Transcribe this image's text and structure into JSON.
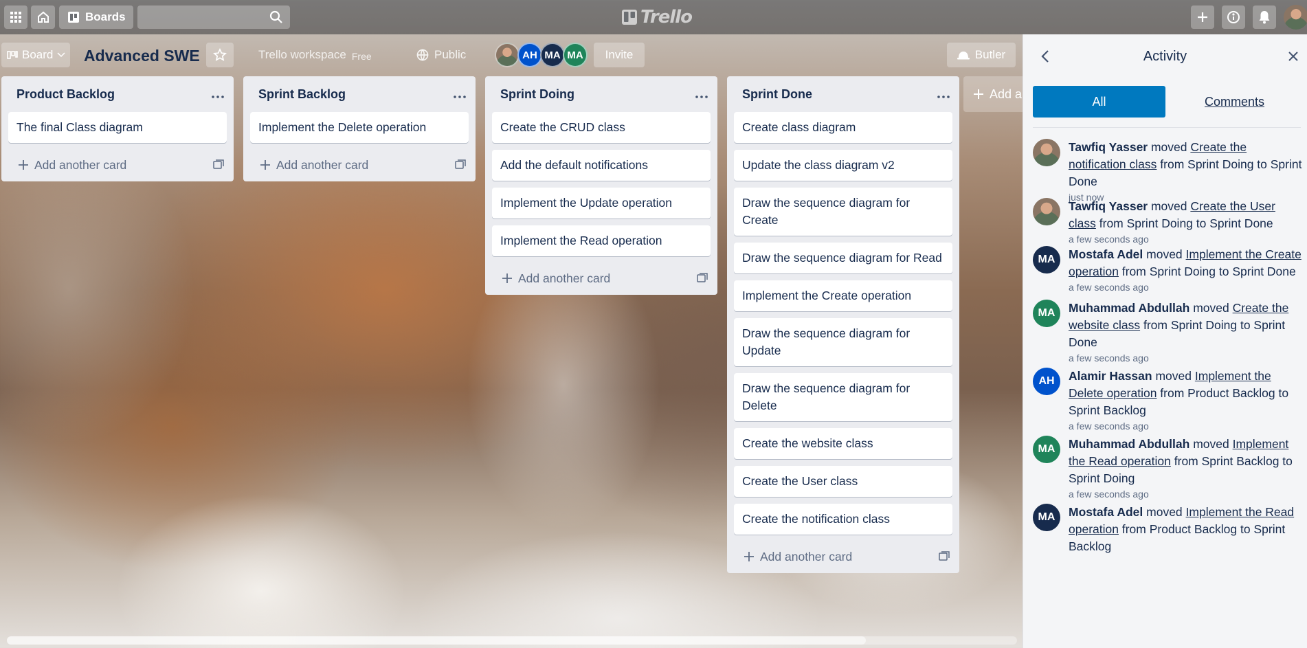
{
  "topbar": {
    "boards_label": "Boards",
    "search_placeholder": "",
    "logo_text": "Trello"
  },
  "board": {
    "view_label": "Board",
    "title": "Advanced SWE",
    "workspace_label": "Trello workspace",
    "workspace_plan": "Free",
    "visibility_label": "Public",
    "members": [
      {
        "initials": "",
        "color": "#8a7564",
        "photo": true
      },
      {
        "initials": "AH",
        "color": "#0052cc"
      },
      {
        "initials": "MA",
        "color": "#172b4d"
      },
      {
        "initials": "MA",
        "color": "#1f845a"
      }
    ],
    "invite_label": "Invite",
    "butler_label": "Butler",
    "add_list_label": "Add a"
  },
  "lists": [
    {
      "title": "Product Backlog",
      "cards": [
        "The final Class diagram"
      ],
      "add_label": "Add another card"
    },
    {
      "title": "Sprint Backlog",
      "cards": [
        "Implement the Delete operation"
      ],
      "add_label": "Add another card"
    },
    {
      "title": "Sprint Doing",
      "cards": [
        "Create the CRUD class",
        "Add the default notifications",
        "Implement the Update operation",
        "Implement the Read operation"
      ],
      "add_label": "Add another card"
    },
    {
      "title": "Sprint Done",
      "cards": [
        "Create class diagram",
        "Update the class diagram v2",
        "Draw the sequence diagram for Create",
        "Draw the sequence diagram for Read",
        "Implement the Create operation",
        "Draw the sequence diagram for Update",
        "Draw the sequence diagram for Delete",
        "Create the website class",
        "Create the User class",
        "Create the notification class"
      ],
      "add_label": "Add another card"
    }
  ],
  "activity": {
    "title": "Activity",
    "tabs": {
      "all": "All",
      "comments": "Comments"
    },
    "items": [
      {
        "user": "Tawfiq Yasser",
        "avatar": "photo",
        "color": "#8a7564",
        "verb": "moved",
        "card": "Create the notification class",
        "rest": "from Sprint Doing to Sprint Done",
        "time": "just now"
      },
      {
        "user": "Tawfiq Yasser",
        "avatar": "photo",
        "color": "#8a7564",
        "verb": "moved",
        "card": "Create the User class",
        "rest": "from Sprint Doing to Sprint Done",
        "time": "a few seconds ago"
      },
      {
        "user": "Mostafa Adel",
        "avatar": "MA",
        "color": "#172b4d",
        "verb": "moved",
        "card": "Implement the Create operation",
        "rest": "from Sprint Doing to Sprint Done",
        "time": "a few seconds ago"
      },
      {
        "user": "Muhammad Abdullah",
        "avatar": "MA",
        "color": "#1f845a",
        "verb": "moved",
        "card": "Create the website class",
        "rest": "from Sprint Doing to Sprint Done",
        "time": "a few seconds ago"
      },
      {
        "user": "Alamir Hassan",
        "avatar": "AH",
        "color": "#0052cc",
        "verb": "moved",
        "card": "Implement the Delete operation",
        "rest": "from Product Backlog to Sprint Backlog",
        "time": "a few seconds ago"
      },
      {
        "user": "Muhammad Abdullah",
        "avatar": "MA",
        "color": "#1f845a",
        "verb": "moved",
        "card": "Implement the Read operation",
        "rest": "from Sprint Backlog to Sprint Doing",
        "time": "a few seconds ago"
      },
      {
        "user": "Mostafa Adel",
        "avatar": "MA",
        "color": "#172b4d",
        "verb": "moved",
        "card": "Implement the Read operation",
        "rest": "from Product Backlog to Sprint Backlog",
        "time": ""
      }
    ]
  }
}
